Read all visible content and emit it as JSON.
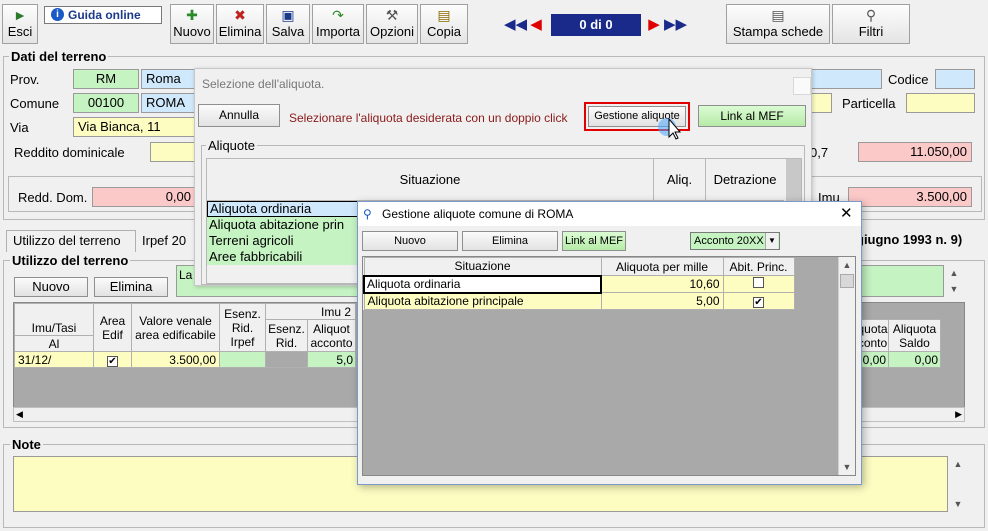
{
  "toolbar": {
    "esci": "Esci",
    "guida": "Guida online",
    "nuovo": "Nuovo",
    "elimina": "Elimina",
    "salva": "Salva",
    "importa": "Importa",
    "opzioni": "Opzioni",
    "copia": "Copia",
    "record_counter": "0 di 0",
    "stampa": "Stampa schede",
    "filtri": "Filtri"
  },
  "dati": {
    "title": "Dati del terreno",
    "prov_label": "Prov.",
    "prov_code": "RM",
    "prov_name": "Roma",
    "comune_label": "Comune",
    "comune_code": "00100",
    "comune_name": "ROMA",
    "via_label": "Via",
    "via_value": "Via Bianca, 11",
    "reddito_label": "Reddito dominicale",
    "codice_label": "Codice",
    "particella_label": "Particella",
    "right_value_1": "11.050,00",
    "right_label_1": "0,7",
    "redd_dom_label": "Redd. Dom.",
    "redd_dom_value": "0,00",
    "imu_label": "Imu",
    "imu_value": "3.500,00"
  },
  "tabs": {
    "tab1": "Utilizzo del terreno",
    "tab2": "Irpef 20",
    "note_right": "giugno 1993 n. 9)"
  },
  "utilizzo": {
    "title": "Utilizzo del terreno",
    "nuovo": "Nuovo",
    "elimina": "Elimina",
    "green_text": "La",
    "headers": {
      "imu_tasi": "Imu/Tasi",
      "al": "Al",
      "area_edif": "Area Edif",
      "valore": "Valore venale area edificabile",
      "esenz_irpef": "Esenz. Rid. Irpef",
      "imu2": "Imu 2",
      "esenz_rid": "Esenz. Rid.",
      "aliq_acconto": "Aliquot acconto",
      "aliq_acconto_r": "quota conto",
      "aliq_saldo": "Aliquota Saldo"
    },
    "row": {
      "date": "31/12/",
      "valore": "3.500,00",
      "acconto": "5,0",
      "acconto_r": "0,00",
      "saldo": "0,00"
    }
  },
  "note": {
    "title": "Note"
  },
  "dialog_sel": {
    "title": "Selezione dell'aliquota.",
    "annulla": "Annulla",
    "message": "Selezionare l'aliquota desiderata con un doppio click",
    "gestione": "Gestione aliquote",
    "link_mef": "Link al MEF",
    "group": "Aliquote",
    "col_situazione": "Situazione",
    "col_aliq": "Aliq.",
    "col_detrazione": "Detrazione",
    "rows": [
      "Aliquota ordinaria",
      "Aliquota abitazione prin",
      "Terreni agricoli",
      "Aree fabbricabili"
    ]
  },
  "dialog_gest": {
    "title": "Gestione aliquote comune di ROMA",
    "nuovo": "Nuovo",
    "elimina": "Elimina",
    "link_mef": "Link al MEF",
    "period": "Acconto 20XX",
    "col_situazione": "Situazione",
    "col_aliq": "Aliquota per mille",
    "col_abit": "Abit. Princ.",
    "rows": [
      {
        "situazione": "Aliquota ordinaria",
        "aliquota": "10,60",
        "abit": false
      },
      {
        "situazione": "Aliquota abitazione principale",
        "aliquota": "5,00",
        "abit": true
      }
    ]
  },
  "colors": {
    "accent_red": "#e00000",
    "nav_blue": "#1a2a8a",
    "green": "#c5f3c2",
    "yellow": "#fdfdc2",
    "pink": "#fcc9c9"
  }
}
